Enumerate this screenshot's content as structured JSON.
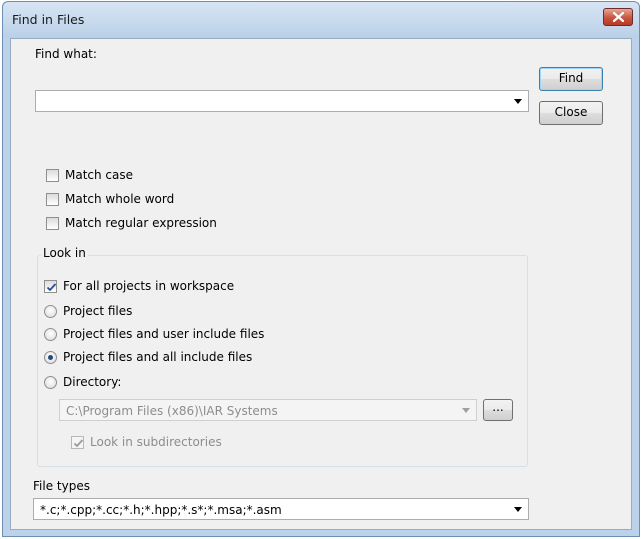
{
  "window": {
    "title": "Find in Files"
  },
  "find_what": {
    "label": "Find what:",
    "value": ""
  },
  "buttons": {
    "find": "Find",
    "close": "Close",
    "browse": "..."
  },
  "options": {
    "match_case": {
      "label": "Match case",
      "checked": false
    },
    "match_whole_word": {
      "label": "Match whole word",
      "checked": false
    },
    "match_regex": {
      "label": "Match regular expression",
      "checked": false
    }
  },
  "look_in": {
    "group_label": "Look in",
    "all_projects": {
      "label": "For all projects in workspace",
      "checked": true
    },
    "radios": [
      {
        "label": "Project files",
        "selected": false
      },
      {
        "label": "Project files and user include files",
        "selected": false
      },
      {
        "label": "Project files and all include files",
        "selected": true
      },
      {
        "label": "Directory:",
        "selected": false
      }
    ],
    "directory_value": "C:\\Program Files (x86)\\IAR Systems",
    "subdirectories": {
      "label": "Look in subdirectories",
      "checked": true,
      "enabled": false
    }
  },
  "file_types": {
    "label": "File types",
    "value": "*.c;*.cpp;*.cc;*.h;*.hpp;*.s*;*.msa;*.asm"
  },
  "icons": {
    "close": "close-x-icon",
    "dropdown": "chevron-down-icon",
    "check": "checkmark-icon"
  }
}
